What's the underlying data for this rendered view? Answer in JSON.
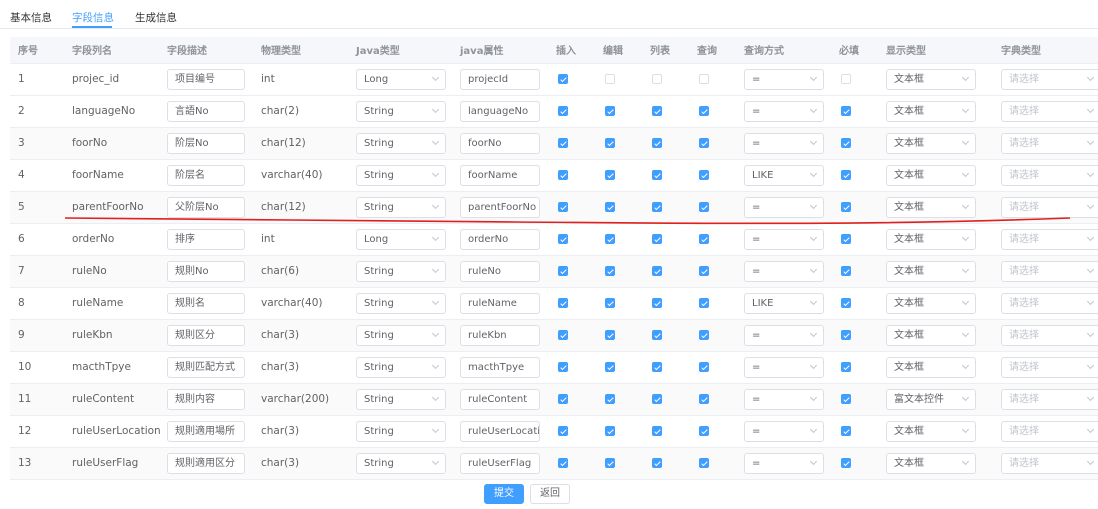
{
  "tabs": [
    {
      "label": "基本信息",
      "active": false
    },
    {
      "label": "字段信息",
      "active": true
    },
    {
      "label": "生成信息",
      "active": false
    }
  ],
  "columns": [
    "序号",
    "字段列名",
    "字段描述",
    "物理类型",
    "Java类型",
    "java属性",
    "插入",
    "编辑",
    "列表",
    "查询",
    "查询方式",
    "必填",
    "显示类型",
    "字典类型"
  ],
  "dict_placeholder": "请选择",
  "rows": [
    {
      "no": "1",
      "column": "projec_id",
      "desc": "项目编号",
      "phys": "int",
      "java_type": "Long",
      "java_field": "projecId",
      "insert": true,
      "edit": false,
      "list": false,
      "query": false,
      "query_type": "=",
      "required": false,
      "html_type": "文本框"
    },
    {
      "no": "2",
      "column": "languageNo",
      "desc": "言語No",
      "phys": "char(2)",
      "java_type": "String",
      "java_field": "languageNo",
      "insert": true,
      "edit": true,
      "list": true,
      "query": true,
      "query_type": "=",
      "required": true,
      "html_type": "文本框"
    },
    {
      "no": "3",
      "column": "foorNo",
      "desc": "阶层No",
      "phys": "char(12)",
      "java_type": "String",
      "java_field": "foorNo",
      "insert": true,
      "edit": true,
      "list": true,
      "query": true,
      "query_type": "=",
      "required": true,
      "html_type": "文本框"
    },
    {
      "no": "4",
      "column": "foorName",
      "desc": "阶层名",
      "phys": "varchar(40)",
      "java_type": "String",
      "java_field": "foorName",
      "insert": true,
      "edit": true,
      "list": true,
      "query": true,
      "query_type": "LIKE",
      "required": true,
      "html_type": "文本框"
    },
    {
      "no": "5",
      "column": "parentFoorNo",
      "desc": "父阶层No",
      "phys": "char(12)",
      "java_type": "String",
      "java_field": "parentFoorNo",
      "insert": true,
      "edit": true,
      "list": true,
      "query": true,
      "query_type": "=",
      "required": true,
      "html_type": "文本框"
    },
    {
      "no": "6",
      "column": "orderNo",
      "desc": "排序",
      "phys": "int",
      "java_type": "Long",
      "java_field": "orderNo",
      "insert": true,
      "edit": true,
      "list": true,
      "query": true,
      "query_type": "=",
      "required": true,
      "html_type": "文本框"
    },
    {
      "no": "7",
      "column": "ruleNo",
      "desc": "规則No",
      "phys": "char(6)",
      "java_type": "String",
      "java_field": "ruleNo",
      "insert": true,
      "edit": true,
      "list": true,
      "query": true,
      "query_type": "=",
      "required": true,
      "html_type": "文本框"
    },
    {
      "no": "8",
      "column": "ruleName",
      "desc": "规則名",
      "phys": "varchar(40)",
      "java_type": "String",
      "java_field": "ruleName",
      "insert": true,
      "edit": true,
      "list": true,
      "query": true,
      "query_type": "LIKE",
      "required": true,
      "html_type": "文本框"
    },
    {
      "no": "9",
      "column": "ruleKbn",
      "desc": "规則区分",
      "phys": "char(3)",
      "java_type": "String",
      "java_field": "ruleKbn",
      "insert": true,
      "edit": true,
      "list": true,
      "query": true,
      "query_type": "=",
      "required": true,
      "html_type": "文本框"
    },
    {
      "no": "10",
      "column": "macthTpye",
      "desc": "规則匹配方式",
      "phys": "char(3)",
      "java_type": "String",
      "java_field": "macthTpye",
      "insert": true,
      "edit": true,
      "list": true,
      "query": true,
      "query_type": "=",
      "required": true,
      "html_type": "文本框"
    },
    {
      "no": "11",
      "column": "ruleContent",
      "desc": "规則内容",
      "phys": "varchar(200)",
      "java_type": "String",
      "java_field": "ruleContent",
      "insert": true,
      "edit": true,
      "list": true,
      "query": true,
      "query_type": "=",
      "required": true,
      "html_type": "富文本控件"
    },
    {
      "no": "12",
      "column": "ruleUserLocation",
      "desc": "规則適用場所",
      "phys": "char(3)",
      "java_type": "String",
      "java_field": "ruleUserLocatio",
      "insert": true,
      "edit": true,
      "list": true,
      "query": true,
      "query_type": "=",
      "required": true,
      "html_type": "文本框"
    },
    {
      "no": "13",
      "column": "ruleUserFlag",
      "desc": "规則適用区分",
      "phys": "char(3)",
      "java_type": "String",
      "java_field": "ruleUserFlag",
      "insert": true,
      "edit": true,
      "list": true,
      "query": true,
      "query_type": "=",
      "required": true,
      "html_type": "文本框"
    }
  ],
  "buttons": {
    "submit": "提交",
    "back": "返回"
  },
  "colors": {
    "accent": "#409eff",
    "annotation_line": "#e0201e"
  }
}
